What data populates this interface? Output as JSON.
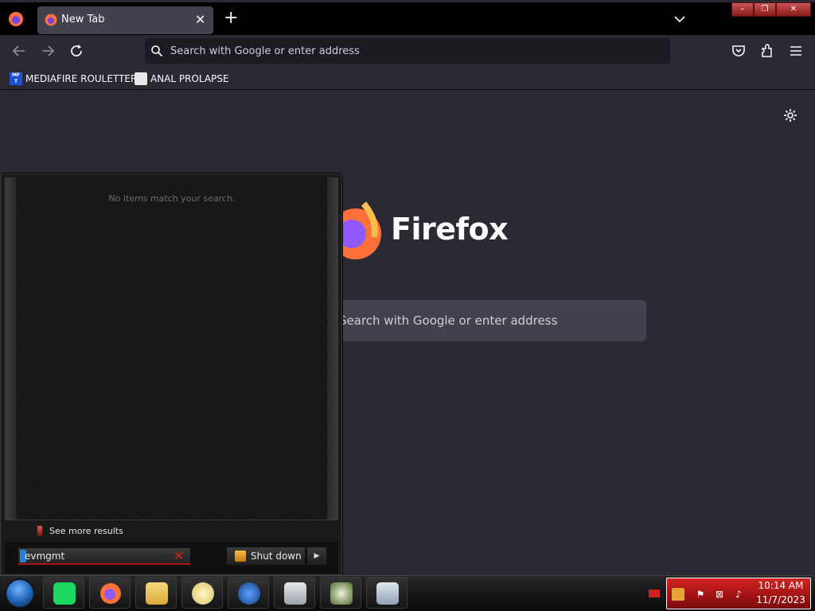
{
  "browser": {
    "tab": {
      "title": "New Tab",
      "close_glyph": "✕"
    },
    "new_tab_glyph": "+",
    "urlbar": {
      "placeholder": "Search with Google or enter address"
    },
    "bookmarks": [
      {
        "label": "MEDIAFIRE ROULETTER",
        "icon": "mediafire-icon"
      },
      {
        "label": "ANAL PROLAPSE",
        "icon": "bookmark-page-icon"
      }
    ],
    "home": {
      "wordmark": "Firefox",
      "search_placeholder": "Search with Google or enter address"
    },
    "window_controls": [
      "–",
      "❐",
      "✕"
    ]
  },
  "start_menu": {
    "no_results_text": "No items match your search.",
    "see_more_label": "See more results",
    "search_value": "evmgmt",
    "shutdown_label": "Shut down",
    "shutdown_arrow": "▶"
  },
  "taskbar": {
    "apps": [
      "spotify-icon",
      "firefox-icon",
      "file-explorer-icon",
      "network-chat-icon",
      "nordvpn-icon",
      "remote-desktop-icon",
      "game-icon",
      "system-monitor-icon"
    ],
    "clock": {
      "time": "10:14 AM",
      "date": "11/7/2023"
    }
  },
  "colors": {
    "browser_bg": "#2b2a33",
    "tab_active": "#42414d",
    "taskbar_tray": "#d42222",
    "win7_orb": "#1f5fb0"
  }
}
